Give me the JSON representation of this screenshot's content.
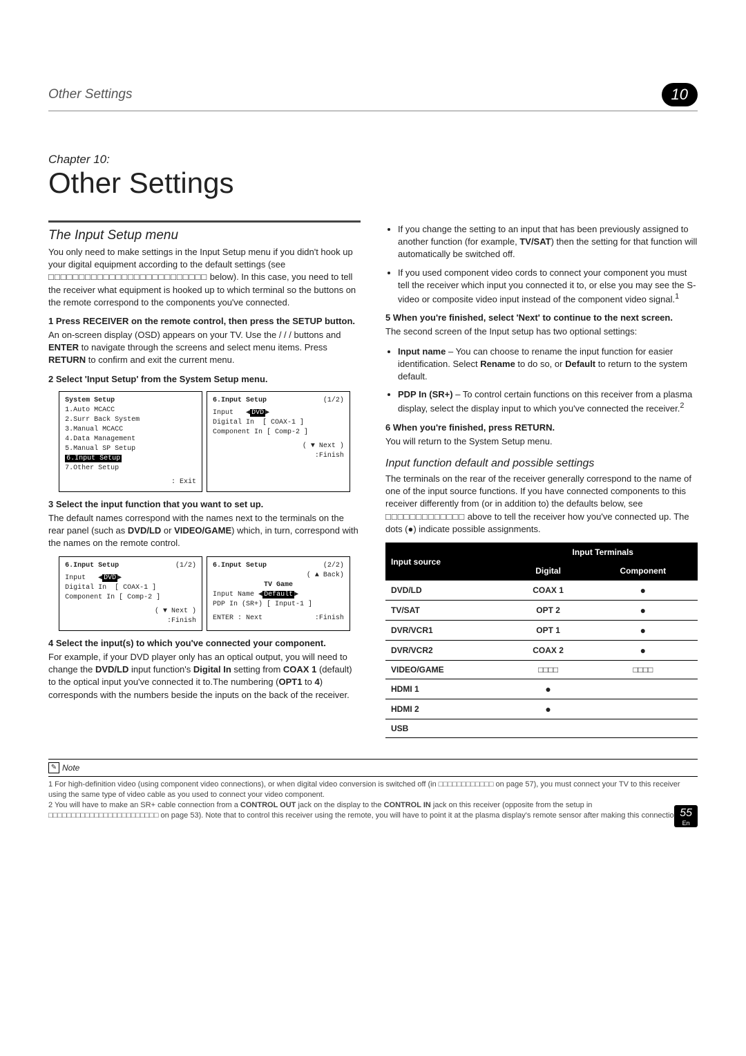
{
  "header": {
    "section": "Other Settings",
    "chapter_num": "10"
  },
  "chapter_label": "Chapter 10:",
  "title": "Other Settings",
  "left": {
    "section_head": "The Input Setup menu",
    "intro1": "You only need to make settings in the Input Setup menu if you didn't hook up your digital equipment according to the default settings (see ",
    "intro1_ref": "□□□□□□□□□□□□□□□□□□□□□□□□□□",
    "intro1_cont": " below). In this case, you need to tell the receiver what equipment is hooked up to which terminal so the buttons on the remote correspond to the components you've connected.",
    "step1": "1    Press RECEIVER on the remote control, then press the SETUP button.",
    "step1_body_a": "An on-screen display (OSD) appears on your TV. Use the  /  /  /   buttons and ",
    "step1_enter": "ENTER",
    "step1_body_b": " to navigate through the screens and select menu items. Press ",
    "step1_return": "RETURN",
    "step1_body_c": " to confirm and exit the current menu.",
    "step2": "2    Select 'Input Setup' from the System Setup menu.",
    "osd1": {
      "title": "System Setup",
      "items": [
        "1.Auto MCACC",
        "2.Surr Back System",
        "3.Manual MCACC",
        "4.Data Management",
        "5.Manual SP Setup",
        "6.Input Setup",
        "7.Other Setup"
      ],
      "hi_index": 5,
      "foot": ": Exit"
    },
    "osd2": {
      "title": "6.Input Setup",
      "page": "(1/2)",
      "rows": [
        {
          "l": "Input",
          "r": "DVD",
          "hi": true,
          "arrows": true
        },
        {
          "l": "Digital In",
          "r": "[ COAX-1 ]"
        },
        {
          "l": "Component In",
          "r": "[ Comp-2 ]"
        }
      ],
      "foot_l": "( ▼ Next )",
      "foot_r": ":Finish"
    },
    "step3": "3    Select the input function that you want to set up.",
    "step3_body_a": "The default names correspond with the names next to the terminals on the rear panel (such as ",
    "step3_b1": "DVD/LD",
    "step3_mid": " or ",
    "step3_b2": "VIDEO/GAME",
    "step3_body_b": ") which, in turn, correspond with the names on the remote control.",
    "osd3": {
      "title": "6.Input Setup",
      "page": "(1/2)",
      "rows": [
        {
          "l": "Input",
          "r": "DVD",
          "hi": true,
          "arrows": true
        },
        {
          "l": "Digital In",
          "r": "[ COAX-1 ]"
        },
        {
          "l": "Component In",
          "r": "[ Comp-2 ]"
        }
      ],
      "foot_l": "( ▼ Next )",
      "foot_r": ":Finish"
    },
    "osd4": {
      "title": "6.Input Setup",
      "page": "(2/2)",
      "back": "( ▲ Back)",
      "sub": "TV Game",
      "rows": [
        {
          "l": "Input Name",
          "r": "Default",
          "hi": true,
          "arrows": true
        },
        {
          "l": "PDP In (SR+)",
          "r": "[ Input-1 ]"
        }
      ],
      "foot_l": "ENTER : Next",
      "foot_r": ":Finish"
    },
    "step4": "4    Select the input(s) to which you've connected your component.",
    "step4_body_a": "For example, if your DVD player only has an optical output, you will need to change the ",
    "s4b1": "DVD/LD",
    "step4_body_b": " input function's ",
    "s4b2": "Digital In",
    "step4_body_c": " setting from ",
    "s4b3": "COAX 1",
    "step4_body_d": " (default) to the optical input you've connected it to.The numbering (",
    "s4b4": "OPT1",
    "step4_body_e": " to ",
    "s4b5": "4",
    "step4_body_f": ") corresponds with the numbers beside the inputs on the back of the receiver."
  },
  "right": {
    "bullet1a": "If you change the setting to an input that has been previously assigned to another function (for example, ",
    "bullet1b": "TV/SAT",
    "bullet1c": ") then the setting for that function will automatically be switched off.",
    "bullet2": "If you used component video cords to connect your component you must tell the receiver which input you connected it to, or else you may see the S-video or composite video input instead of the component video signal.",
    "fn1": "1",
    "step5": "5    When you're finished, select 'Next' to continue to the next screen.",
    "step5_body": "The second screen of the Input setup has two optional settings:",
    "opt1_label": "Input name",
    "opt1_body_a": " – You can choose to rename the input function for easier identification. Select ",
    "opt1_b1": "Rename",
    "opt1_body_b": " to do so, or ",
    "opt1_b2": "Default",
    "opt1_body_c": " to return to the system default.",
    "opt2_label": "PDP In (SR+)",
    "opt2_body": " – To control certain functions on this receiver from a plasma display, select the display input to which you've connected the receiver.",
    "fn2": "2",
    "step6": "6    When you're finished, press RETURN.",
    "step6_body": "You will return to the System Setup menu.",
    "sub_head": "Input function default and possible settings",
    "sub_body_a": "The terminals on the rear of the receiver generally correspond to the name of one of the input source functions. If you have connected components to this receiver differently from (or in addition to) the defaults below, see ",
    "sub_ref": "□□□□□□□□□□□□□",
    "sub_body_b": " above to tell the receiver how you've connected up. The dots (●) indicate possible assignments.",
    "table": {
      "head_src": "Input source",
      "head_group": "Input Terminals",
      "head_dig": "Digital",
      "head_comp": "Component",
      "rows": [
        {
          "src": "DVD/LD",
          "dig": "COAX 1",
          "comp": "●"
        },
        {
          "src": "TV/SAT",
          "dig": "OPT 2",
          "comp": "●"
        },
        {
          "src": "DVR/VCR1",
          "dig": "OPT 1",
          "comp": "●"
        },
        {
          "src": "DVR/VCR2",
          "dig": "COAX 2",
          "comp": "●"
        },
        {
          "src": "VIDEO/GAME",
          "dig": "□□□□",
          "comp": "□□□□"
        },
        {
          "src": "HDMI 1",
          "dig": "●",
          "comp": ""
        },
        {
          "src": "HDMI 2",
          "dig": "●",
          "comp": ""
        },
        {
          "src": "USB",
          "dig": "",
          "comp": ""
        }
      ]
    }
  },
  "note_label": "Note",
  "footnote1": "1  For high-definition video (using component video connections), or when digital video conversion is switched off (in □□□□□□□□□□□□ on page 57), you must connect your TV to this receiver using the same type of video cable as you used to connect your video component.",
  "footnote2a": "2  You will have to make an SR+ cable connection from a ",
  "fn2_b1": "CONTROL OUT",
  "footnote2b": " jack on the display to the ",
  "fn2_b2": "CONTROL IN",
  "footnote2c": " jack on this receiver (opposite from the setup in □□□□□□□□□□□□□□□□□□□□□□□□ on page 53). Note that to control this receiver using the remote, you will have to point it at the plasma display's remote sensor after making this connection.",
  "page_num": "55",
  "page_lang": "En"
}
